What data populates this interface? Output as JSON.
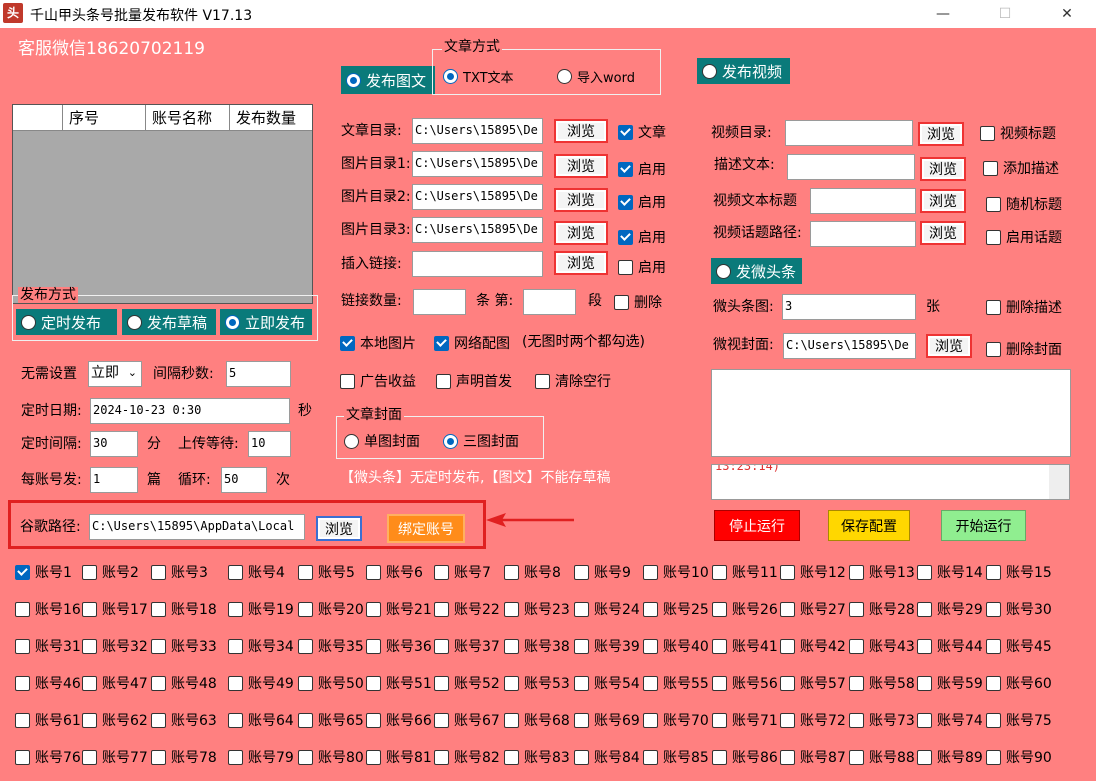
{
  "window": {
    "icon_text": "头",
    "title": "千山甲头条号批量发布软件 V17.13",
    "minimize": "—",
    "maximize": "☐",
    "close": "✕"
  },
  "service": "客服微信18620702119",
  "grid": {
    "columns": [
      "",
      "序号",
      "账号名称",
      "发布数量"
    ]
  },
  "publish_mode": {
    "title": "发布方式",
    "options": [
      "定时发布",
      "发布草稿",
      "立即发布"
    ],
    "selected": 2
  },
  "article_mode": {
    "title": "文章方式",
    "options": [
      "TXT文本",
      "导入word"
    ],
    "selected": 0
  },
  "publish_image_text": "发布图文",
  "publish_video": "发布视频",
  "weitoutiao": "发微头条",
  "article": {
    "rows": [
      {
        "label": "文章目录:",
        "value": "C:\\Users\\15895\\De",
        "browse": "浏览",
        "check_label": "文章",
        "checked": true
      },
      {
        "label": "图片目录1:",
        "value": "C:\\Users\\15895\\De",
        "browse": "浏览",
        "check_label": "启用",
        "checked": true
      },
      {
        "label": "图片目录2:",
        "value": "C:\\Users\\15895\\De",
        "browse": "浏览",
        "check_label": "启用",
        "checked": true
      },
      {
        "label": "图片目录3:",
        "value": "C:\\Users\\15895\\De",
        "browse": "浏览",
        "check_label": "启用",
        "checked": true
      },
      {
        "label": "插入链接:",
        "value": "",
        "browse": "浏览",
        "check_label": "启用",
        "checked": false
      }
    ],
    "link_count_label": "链接数量:",
    "link_count": "",
    "para_label1": "条 第:",
    "para_value": "",
    "para_label2": "段",
    "delete_label": "删除",
    "delete_checked": false,
    "local_image": "本地图片",
    "local_image_checked": true,
    "net_image": "网络配图",
    "net_image_checked": true,
    "image_note": "(无图时两个都勾选)",
    "ad_income": "广告收益",
    "declare_first": "声明首发",
    "clear_empty": "清除空行"
  },
  "cover": {
    "title": "文章封面",
    "options": [
      "单图封面",
      "三图封面"
    ],
    "selected": 1
  },
  "notice": "【微头条】无定时发布,【图文】不能存草稿",
  "settings": {
    "no_need_label": "无需设置",
    "mode_value": "立即",
    "interval_label": "间隔秒数:",
    "interval_value": "5",
    "date_label": "定时日期:",
    "date_value": "2024-10-23  0:30",
    "sec_unit": "秒",
    "timer_gap_label": "定时间隔:",
    "timer_gap_value": "30",
    "minute_unit": "分",
    "upload_wait_label": "上传等待:",
    "upload_wait_value": "10",
    "per_account_label": "每账号发:",
    "per_account_value": "1",
    "article_unit": "篇",
    "loop_label": "循环:",
    "loop_value": "50",
    "times_unit": "次"
  },
  "chrome": {
    "label": "谷歌路径:",
    "value": "C:\\Users\\15895\\AppData\\Local",
    "browse": "浏览",
    "bind": "绑定账号"
  },
  "video": {
    "rows": [
      {
        "label": "视频目录:",
        "value": "",
        "browse": "浏览",
        "check_label": "视频标题",
        "checked": false
      },
      {
        "label": "描述文本:",
        "value": "",
        "browse": "浏览",
        "check_label": "添加描述",
        "checked": false
      },
      {
        "label": "视频文本标题",
        "value": "",
        "browse": "浏览",
        "check_label": "随机标题",
        "checked": false
      },
      {
        "label": "视频话题路径:",
        "value": "",
        "browse": "浏览",
        "check_label": "启用话题",
        "checked": false
      }
    ]
  },
  "micro": {
    "count_label": "微头条图:",
    "count_value": "3",
    "count_unit": "张",
    "delete_desc": "删除描述",
    "cover_label": "微视封面:",
    "cover_value": "C:\\Users\\15895\\De",
    "browse": "浏览",
    "delete_cover": "删除封面"
  },
  "log_text": "13:23:14)",
  "actions": {
    "stop": "停止运行",
    "save": "保存配置",
    "start": "开始运行"
  },
  "accounts_checked": [
    1
  ]
}
